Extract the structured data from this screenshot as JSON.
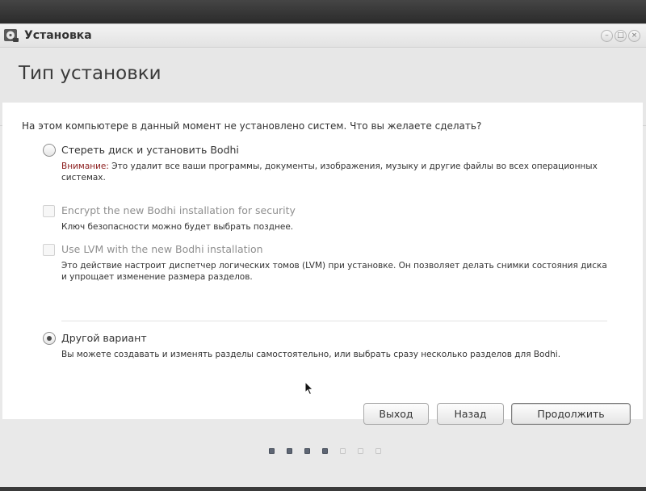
{
  "window": {
    "title": "Установка",
    "icon": "installer-disc-icon",
    "controls": {
      "minimize": "–",
      "maximize": "□",
      "close": "×"
    }
  },
  "header": {
    "title": "Тип установки"
  },
  "question": "На этом компьютере в данный момент не установлено систем. Что вы желаете сделать?",
  "options": [
    {
      "type": "radio",
      "label": "Стереть диск и установить Bodhi",
      "warning_prefix": "Внимание:",
      "description": " Это удалит все ваши программы, документы, изображения, музыку и другие файлы во всех операционных системах.",
      "checked": false,
      "enabled": true
    },
    {
      "type": "checkbox",
      "label": "Encrypt the new Bodhi installation for security",
      "description": "Ключ безопасности можно будет выбрать позднее.",
      "checked": false,
      "enabled": false
    },
    {
      "type": "checkbox",
      "label": "Use LVM with the new Bodhi installation",
      "description": "Это действие настроит диспетчер логических томов (LVM) при установке. Он позволяет делать снимки состояния диска и упрощает изменение размера разделов.",
      "checked": false,
      "enabled": false
    },
    {
      "type": "radio",
      "label": "Другой вариант",
      "description": "Вы можете создавать и изменять разделы самостоятельно, или выбрать сразу несколько разделов для Bodhi.",
      "checked": true,
      "enabled": true
    }
  ],
  "buttons": {
    "quit": "Выход",
    "back": "Назад",
    "continue": "Продолжить"
  },
  "progress": {
    "total_steps": 7,
    "completed_steps": 4
  },
  "colors": {
    "warning": "#8b1c1c",
    "step_filled": "#5e6674",
    "step_empty": "#ececec"
  }
}
